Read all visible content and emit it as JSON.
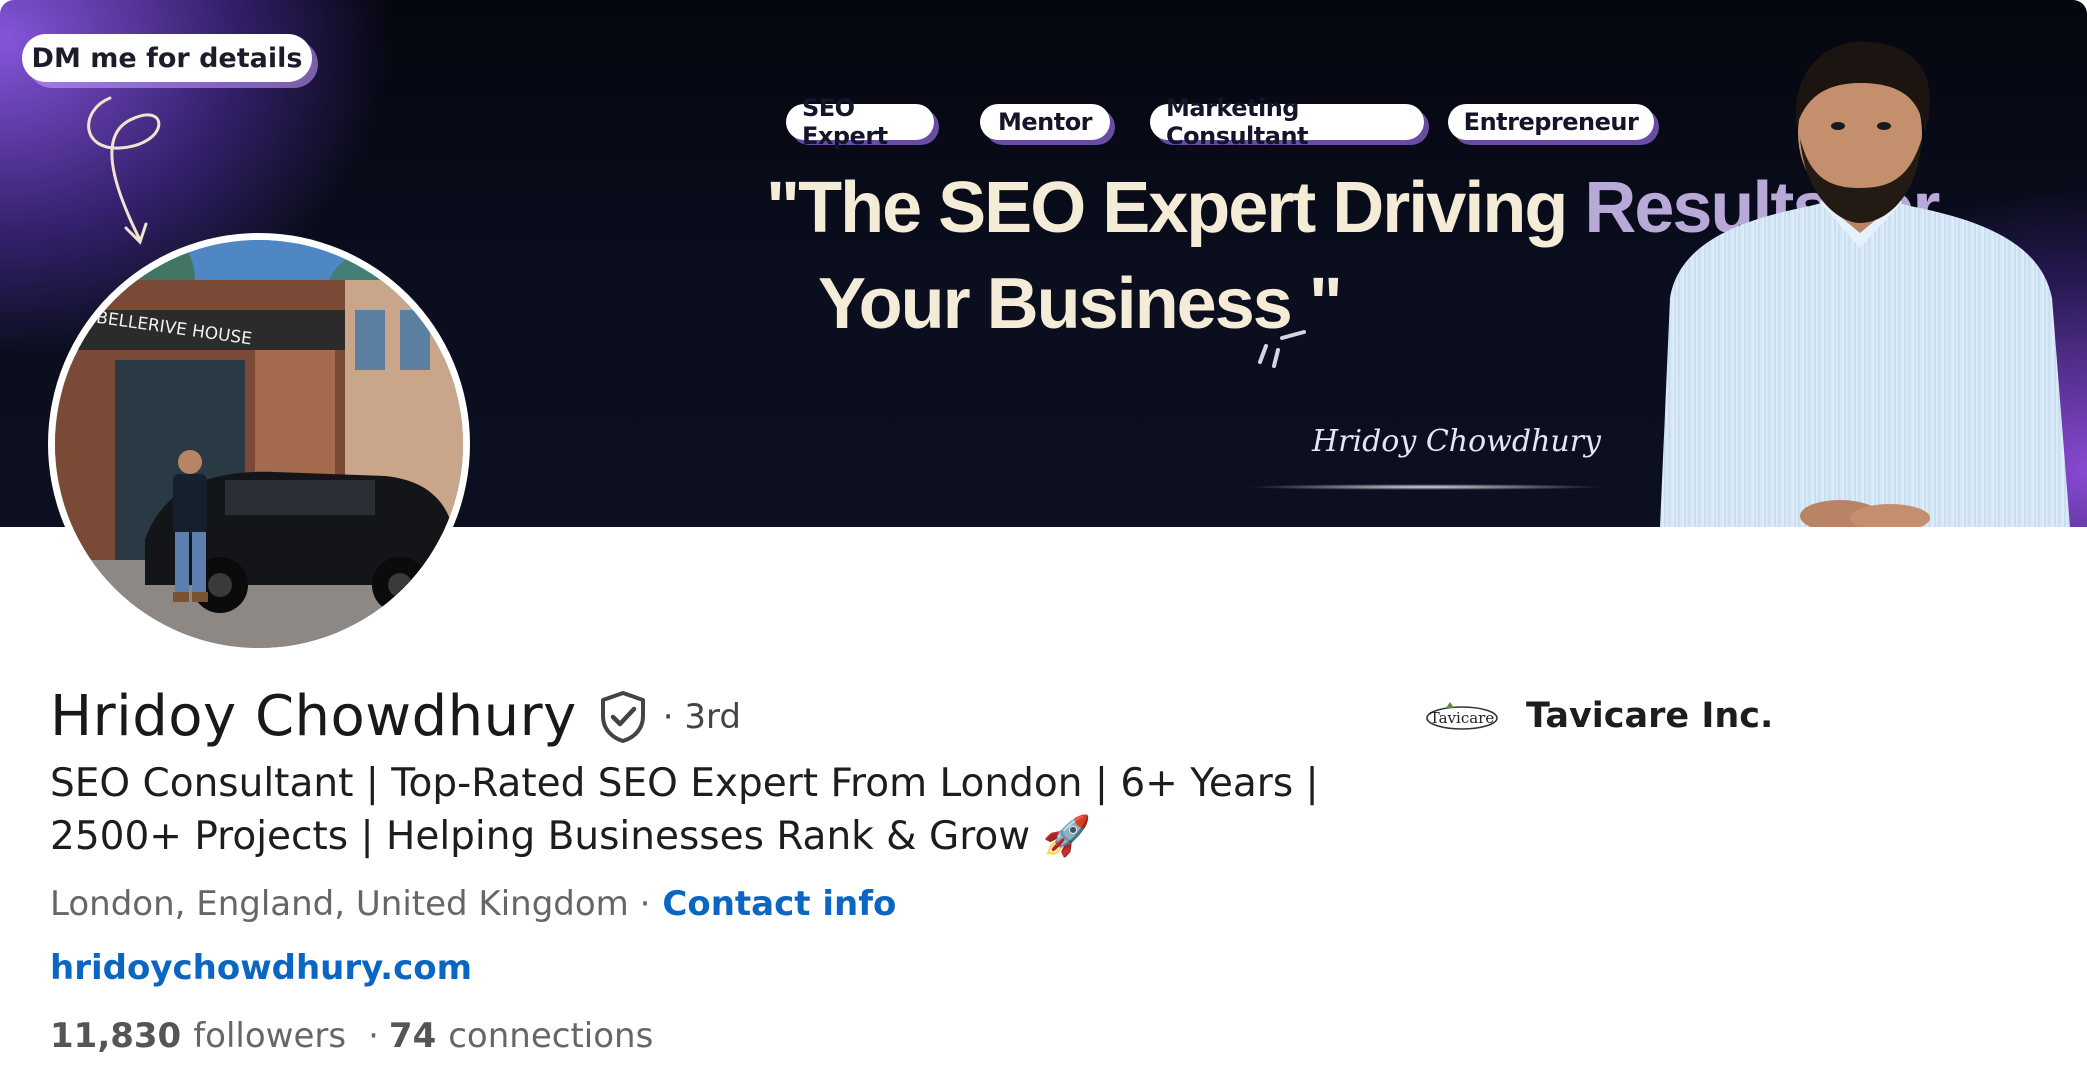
{
  "banner": {
    "dm_label": "DM me for details",
    "tags": [
      "SEO Expert",
      "Mentor",
      "Marketing Consultant",
      "Entrepreneur"
    ],
    "quote_line1_a": "\"The SEO Expert Driving",
    "quote_line1_b": "Results for",
    "quote_line2": "Your Business \"",
    "signature": "Hridoy Chowdhury"
  },
  "avatar": {
    "building_sign": "BELLERIVE HOUSE"
  },
  "profile": {
    "name": "Hridoy Chowdhury",
    "degree": "· 3rd",
    "headline_line1": "SEO Consultant | Top-Rated SEO Expert From London | 6+ Years |",
    "headline_line2": "2500+ Projects | Helping Businesses Rank & Grow 🚀",
    "location": "London, England, United Kingdom ·",
    "contact_info": "Contact info",
    "website": "hridoychowdhury.com",
    "followers_count": "11,830",
    "followers_label": "followers",
    "connections_sep": "·",
    "connections_count": "74",
    "connections_label": "connections"
  },
  "company": {
    "logo_text": "Tavicare",
    "name": "Tavicare Inc."
  },
  "colors": {
    "link": "#0a66c2",
    "text_primary": "#191919",
    "text_secondary": "#666666",
    "banner_bg": "#0a0e1e",
    "banner_accent": "#8c5ae6"
  },
  "icons": {
    "verified": "shield-check-icon",
    "squiggle": "curly-arrow-icon"
  }
}
